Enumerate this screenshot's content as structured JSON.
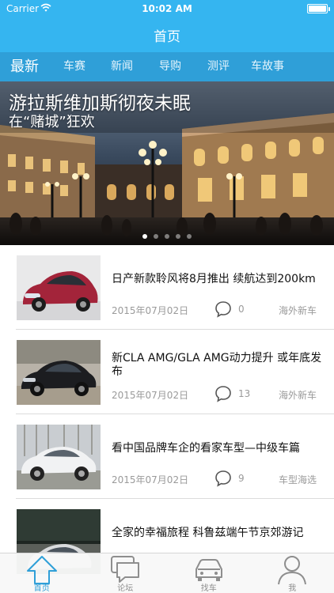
{
  "status_bar": {
    "carrier": "Carrier",
    "time": "10:02 AM"
  },
  "nav": {
    "title": "首页"
  },
  "categories": [
    {
      "label": "最新",
      "active": true
    },
    {
      "label": "车赛",
      "active": false
    },
    {
      "label": "新闻",
      "active": false
    },
    {
      "label": "导购",
      "active": false
    },
    {
      "label": "测评",
      "active": false
    },
    {
      "label": "车故事",
      "active": false
    }
  ],
  "banner": {
    "title": "游拉斯维加斯彻夜未眠",
    "subtitle": "在“赌城”狂欢",
    "page_count": 5,
    "current_page": 1
  },
  "news": [
    {
      "title": "日产新款聆风将8月推出 续航达到200km",
      "date": "2015年07月02日",
      "comments": "0",
      "tag": "海外新车",
      "thumb": "red-hatchback"
    },
    {
      "title": "新CLA AMG/GLA AMG动力提升 或年底发布",
      "date": "2015年07月02日",
      "comments": "13",
      "tag": "海外新车",
      "thumb": "black-coupe"
    },
    {
      "title": "看中国品牌车企的看家车型—中级车篇",
      "date": "2015年07月02日",
      "comments": "9",
      "tag": "车型海选",
      "thumb": "white-sedan"
    },
    {
      "title": "全家的幸福旅程 科鲁兹端午节京郊游记",
      "date": "",
      "comments": "",
      "tag": "",
      "thumb": "silver-sedan"
    }
  ],
  "tabs": [
    {
      "label": "首页",
      "icon": "home-arrow-icon",
      "active": true
    },
    {
      "label": "论坛",
      "icon": "forum-icon",
      "active": false
    },
    {
      "label": "找车",
      "icon": "car-icon",
      "active": false
    },
    {
      "label": "我",
      "icon": "profile-icon",
      "active": false
    }
  ],
  "colors": {
    "accent": "#35b5f0",
    "category_bar": "#2f9fd8",
    "meta_text": "#9a9a9a"
  }
}
